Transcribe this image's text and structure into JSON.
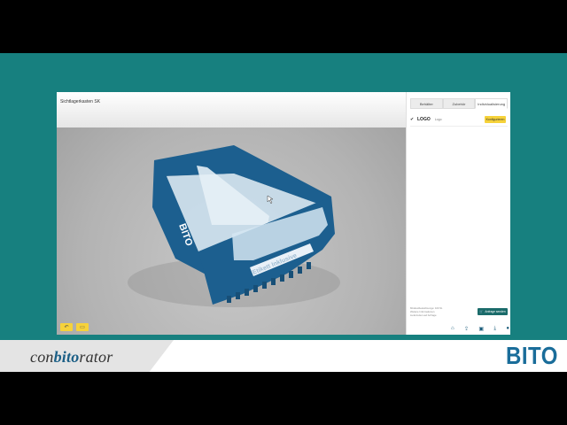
{
  "app": {
    "title": "Sichtlagerkasten SK"
  },
  "panel": {
    "tabs": [
      {
        "label": "Behälter",
        "active": false
      },
      {
        "label": "Zubehör",
        "active": false
      },
      {
        "label": "Individualisierung",
        "active": true
      }
    ],
    "config_row": {
      "check_icon": "✔",
      "label": "LOGO",
      "value": "Logo",
      "button_label": "Konfigurieren"
    },
    "summary_lines": [
      "Mindestbestellmenge: 100 St.",
      "Weitere Informationen",
      "Lieferzeiten auf Anfrage"
    ],
    "order_button": {
      "icon": "cart-icon",
      "label": "Anfrage senden"
    },
    "toolbar_icons": [
      "home-icon",
      "share-icon",
      "save-icon",
      "download-icon",
      "user-icon"
    ]
  },
  "viewport": {
    "box_labels": {
      "brand": "BITO",
      "label_strip": "Etikett Inklusive"
    },
    "bottom_buttons": [
      "undo-icon",
      "camera-icon"
    ]
  },
  "branding": {
    "conbitorator_pre": "con",
    "conbitorator_bit": "bito",
    "conbitorator_post": "rator",
    "bito": "BITO"
  },
  "colors": {
    "teal": "#17807f",
    "box_blue": "#1c5f8f",
    "accent_yellow": "#f6d23a"
  }
}
